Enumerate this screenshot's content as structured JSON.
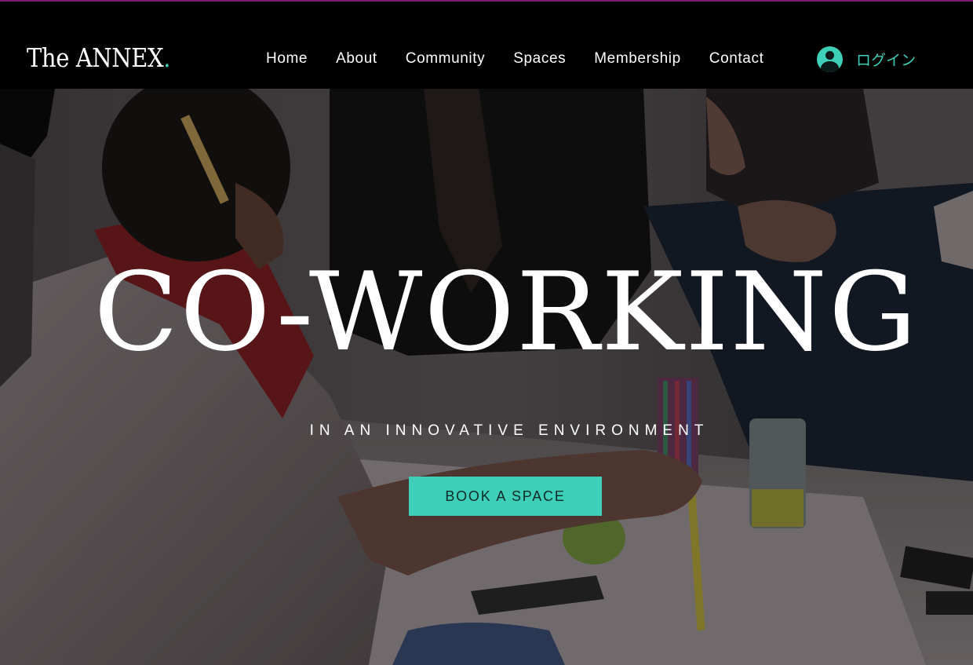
{
  "site": {
    "logo_text": "The ANNEX",
    "logo_dot": "."
  },
  "nav": {
    "items": [
      {
        "label": "Home"
      },
      {
        "label": "About"
      },
      {
        "label": "Community"
      },
      {
        "label": "Spaces"
      },
      {
        "label": "Membership"
      },
      {
        "label": "Contact"
      }
    ],
    "login_label": "ログイン"
  },
  "hero": {
    "title": "CO-WORKING",
    "subtitle": "IN AN INNOVATIVE ENVIRONMENT",
    "cta_label": "BOOK A SPACE"
  },
  "colors": {
    "accent": "#3ecfb8",
    "header_bg": "#000000",
    "top_accent": "#7a1a72",
    "text": "#ffffff"
  },
  "icons": {
    "login": "user-avatar-icon"
  }
}
